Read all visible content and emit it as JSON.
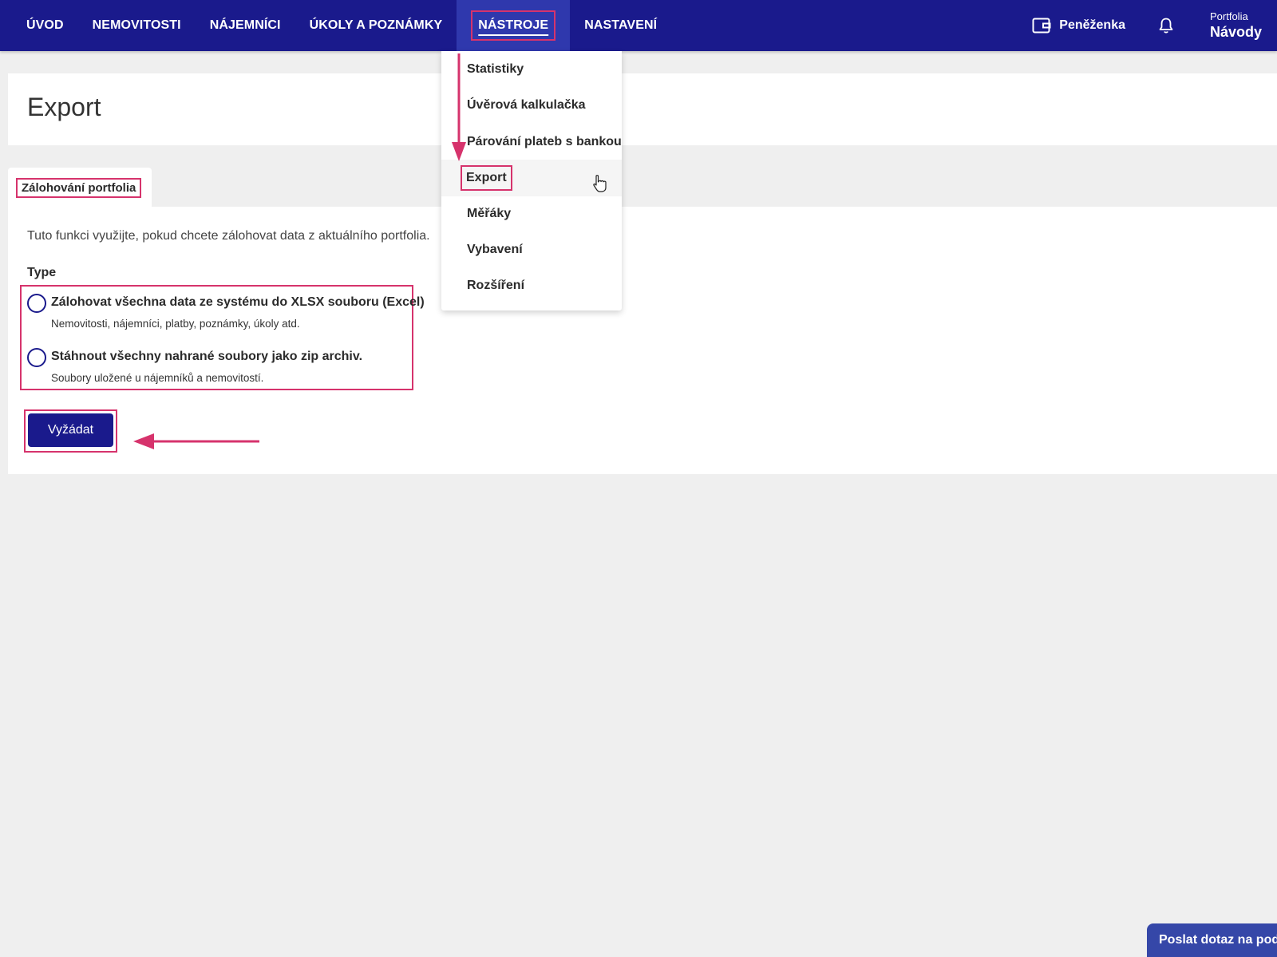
{
  "nav": {
    "items": [
      {
        "label": "ÚVOD"
      },
      {
        "label": "NEMOVITOSTI"
      },
      {
        "label": "NÁJEMNÍCI"
      },
      {
        "label": "ÚKOLY A POZNÁMKY"
      },
      {
        "label": "NÁSTROJE",
        "active": true
      },
      {
        "label": "NASTAVENÍ"
      }
    ],
    "wallet_label": "Peněženka",
    "portfolio_small": "Portfolia",
    "portfolio_big": "Návody"
  },
  "dropdown": {
    "items": [
      {
        "label": "Statistiky"
      },
      {
        "label": "Úvěrová kalkulačka"
      },
      {
        "label": "Párování plateb s bankou"
      },
      {
        "label": "Export",
        "hovered": true
      },
      {
        "label": "Měřáky"
      },
      {
        "label": "Vybavení"
      },
      {
        "label": "Rozšíření"
      }
    ]
  },
  "page": {
    "title": "Export",
    "tab_label": "Zálohování portfolia",
    "description": "Tuto funkci využijte, pokud chcete zálohovat data z aktuálního portfolia.",
    "type_label": "Type",
    "options": [
      {
        "title": "Zálohovat všechna data ze systému do XLSX souboru (Excel)",
        "subtitle": "Nemovitosti, nájemníci, platby, poznámky, úkoly atd.",
        "checked": false
      },
      {
        "title": "Stáhnout všechny nahrané soubory jako zip archiv.",
        "subtitle": "Soubory uložené u nájemníků a nemovitostí.",
        "checked": false
      }
    ],
    "submit_label": "Vyžádat"
  },
  "support_label": "Poslat dotaz na podporu",
  "colors": {
    "nav_bg": "#1a1a8c",
    "nav_active_bg": "#2f38ad",
    "highlight": "#d6336c",
    "button_bg": "#1a1a8c",
    "support_bg": "#3547a8"
  },
  "icons": [
    "wallet-icon",
    "bell-icon",
    "hand-cursor-icon",
    "arrow-down-annotation",
    "arrow-left-annotation"
  ]
}
